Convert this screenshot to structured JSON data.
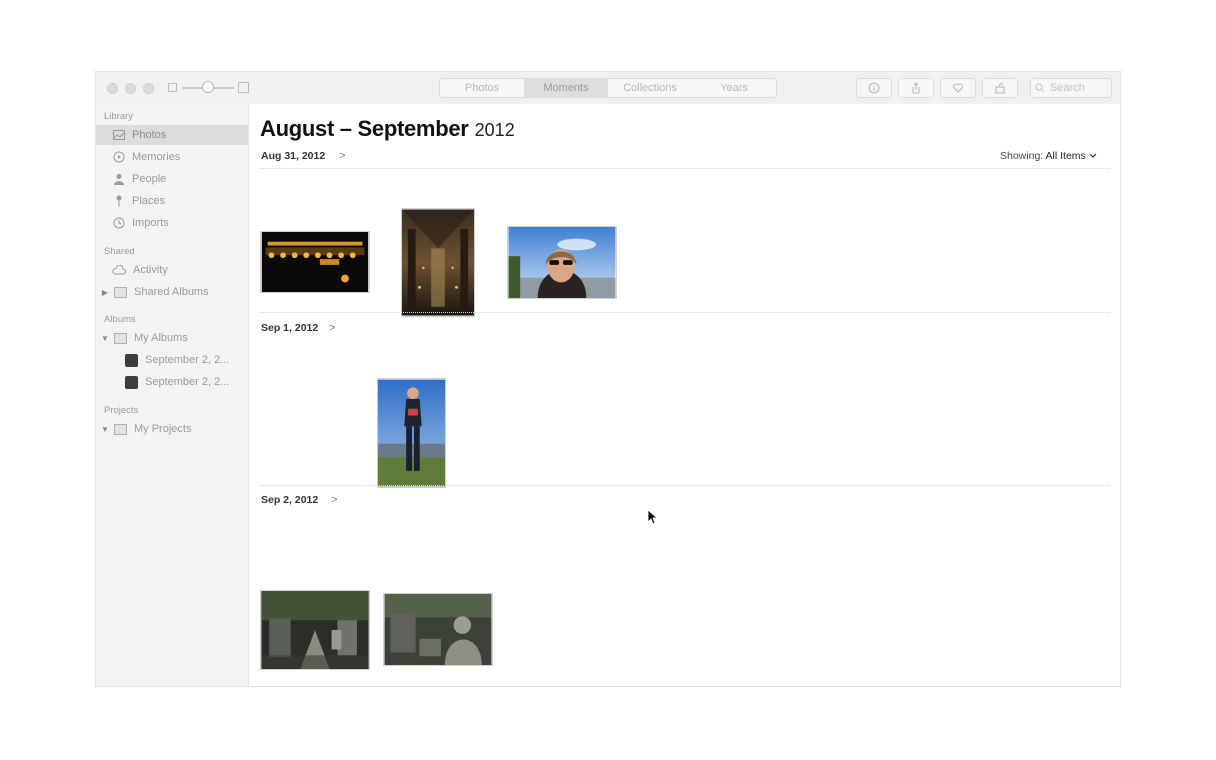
{
  "toolbar": {
    "tabs": [
      {
        "label": "Photos",
        "active": false
      },
      {
        "label": "Moments",
        "active": true
      },
      {
        "label": "Collections",
        "active": false
      },
      {
        "label": "Years",
        "active": false
      }
    ],
    "search_placeholder": "Search"
  },
  "sidebar": {
    "library": {
      "heading": "Library",
      "items": [
        {
          "label": "Photos",
          "icon": "photos-icon",
          "selected": true
        },
        {
          "label": "Memories",
          "icon": "memories-icon"
        },
        {
          "label": "People",
          "icon": "people-icon"
        },
        {
          "label": "Places",
          "icon": "places-icon"
        },
        {
          "label": "Imports",
          "icon": "imports-icon"
        }
      ]
    },
    "shared": {
      "heading": "Shared",
      "items": [
        {
          "label": "Activity",
          "icon": "cloud-icon"
        },
        {
          "label": "Shared Albums",
          "icon": "folder-icon"
        }
      ]
    },
    "albums": {
      "heading": "Albums",
      "items": [
        {
          "label": "My Albums",
          "icon": "folder-icon"
        },
        {
          "label": "September 2, 2..."
        },
        {
          "label": "September 2, 2..."
        }
      ]
    },
    "projects": {
      "heading": "Projects",
      "items": [
        {
          "label": "My Projects",
          "icon": "folder-icon"
        }
      ]
    }
  },
  "main": {
    "title_bold": "August – September",
    "title_year": "2012",
    "showing_label": "Showing:",
    "showing_value": "All Items",
    "moments": [
      {
        "date": "Aug 31, 2012",
        "chevron": ">"
      },
      {
        "date": "Sep 1, 2012",
        "chevron": ">"
      },
      {
        "date": "Sep 2, 2012",
        "chevron": ">"
      }
    ]
  },
  "colors": {
    "sidebar_bg": "#f3f3f3",
    "selection": "#dcdcdc",
    "toolbar_bg": "#f1f1f1"
  }
}
